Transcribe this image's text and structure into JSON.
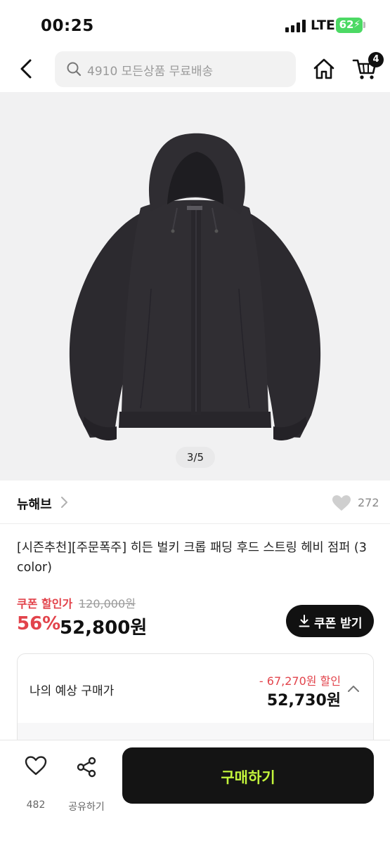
{
  "status_bar": {
    "time": "00:25",
    "network": "LTE",
    "battery": "62"
  },
  "header": {
    "search_placeholder": "4910 모든상품 무료배송",
    "cart_count": "4",
    "icons": [
      "chevron-left-icon",
      "search-icon",
      "home-icon",
      "cart-icon"
    ]
  },
  "gallery": {
    "counter": "3/5"
  },
  "brand": {
    "name": "뉴해브",
    "likes": "272"
  },
  "product": {
    "title": "[시즌추천][주문폭주] 히든 벌키 크롭 패딩 후드 스트링 헤비 점퍼 (3 color)"
  },
  "price": {
    "coupon_label": "쿠폰 할인가",
    "original": "120,000원",
    "discount_rate": "56%",
    "sale": "52,800원",
    "coupon_button": "쿠폰 받기"
  },
  "estimate": {
    "label": "나의 예상 구매가",
    "discount": "- 67,270원 할인",
    "price": "52,730원"
  },
  "bottom_bar": {
    "wish_count": "482",
    "share_label": "공유하기",
    "buy_label": "구매하기"
  },
  "colors": {
    "accent_red": "#e2434b",
    "buy_button": "#141414",
    "buy_text": "#c3f53c",
    "battery": "#4cd964"
  }
}
